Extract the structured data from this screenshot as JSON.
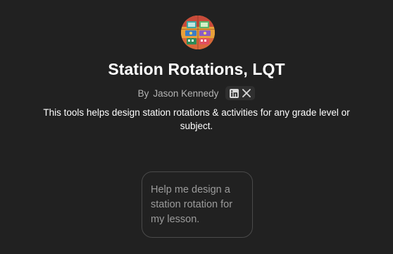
{
  "gpt": {
    "name": "Station Rotations, LQT",
    "author_prefix": "By",
    "author": "Jason Kennedy",
    "description": "This tools helps design station rotations & activities for any grade level or subject."
  },
  "socials": [
    {
      "icon": "linkedin-icon"
    },
    {
      "icon": "x-icon"
    }
  ],
  "conversation_starters": [
    "Help me design a station rotation for my lesson."
  ],
  "colors": {
    "background": "#212121",
    "text_primary": "#ffffff",
    "text_secondary": "#b4b4b4",
    "starter_border": "#4a4a4a"
  }
}
